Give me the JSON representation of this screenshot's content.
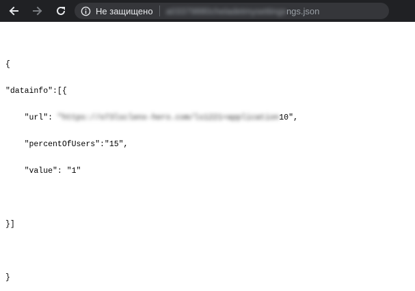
{
  "browser": {
    "security_label": "Не защищено",
    "url_blurred": "a03379880cheladetmysettings",
    "url_tail": "ngs.json"
  },
  "json_view": {
    "lines": {
      "l1": "{",
      "l2": "\"datainfo\":[{",
      "l3_indent": "    \"url\": ",
      "l3_blurred": "\"https://o73lsclenx-hero.com/ls1221=application",
      "l3_tail": "10\",",
      "l4": "    \"percentOfUsers\":\"15\",",
      "l5": "    \"value\": \"1\"",
      "l7": "}]",
      "l9": "}"
    }
  },
  "colors": {
    "toolbar_bg": "#202124",
    "omnibox_bg": "#35363a",
    "text_light": "#e8eaed",
    "url_gray": "#9aa0a6"
  }
}
